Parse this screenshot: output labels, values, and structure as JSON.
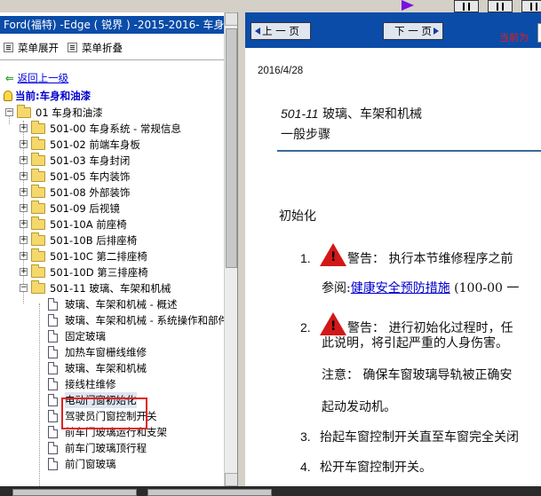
{
  "left_panel": {
    "title": "Ford(福特) -Edge ( 锐界 ) -2015-2016- 车身和",
    "expand_label": "菜单展开",
    "collapse_label": "菜单折叠",
    "back_label": "返回上一级",
    "current_label": "当前:车身和油漆",
    "tree": [
      {
        "label": "01 车身和油漆",
        "type": "folder",
        "expanded": true
      },
      {
        "label": "501-00 车身系统 - 常规信息",
        "type": "folder"
      },
      {
        "label": "501-02 前端车身板",
        "type": "folder"
      },
      {
        "label": "501-03 车身封闭",
        "type": "folder"
      },
      {
        "label": "501-05 车内装饰",
        "type": "folder"
      },
      {
        "label": "501-08 外部装饰",
        "type": "folder"
      },
      {
        "label": "501-09 后视镜",
        "type": "folder"
      },
      {
        "label": "501-10A 前座椅",
        "type": "folder"
      },
      {
        "label": "501-10B 后排座椅",
        "type": "folder"
      },
      {
        "label": "501-10C 第二排座椅",
        "type": "folder"
      },
      {
        "label": "501-10D 第三排座椅",
        "type": "folder"
      },
      {
        "label": "501-11 玻璃、车架和机械",
        "type": "folder",
        "expanded": true
      },
      {
        "label": "玻璃、车架和机械 - 概述",
        "type": "doc"
      },
      {
        "label": "玻璃、车架和机械 - 系统操作和部件",
        "type": "doc"
      },
      {
        "label": "固定玻璃",
        "type": "doc"
      },
      {
        "label": "加热车窗栅线维修",
        "type": "doc"
      },
      {
        "label": "玻璃、车架和机械",
        "type": "doc"
      },
      {
        "label": "接线柱维修",
        "type": "doc"
      },
      {
        "label": "电动门窗初始化",
        "type": "doc",
        "selected": true
      },
      {
        "label": "驾驶员门窗控制开关",
        "type": "doc"
      },
      {
        "label": "前车门玻璃运行和支架",
        "type": "doc"
      },
      {
        "label": "前车门玻璃顶行程",
        "type": "doc"
      },
      {
        "label": "前门窗玻璃",
        "type": "doc"
      }
    ]
  },
  "nav": {
    "prev_label": "上 一 页",
    "next_label": "下 一 页",
    "current_page_label": "当前为"
  },
  "doc": {
    "date": "2016/4/28",
    "code": "501-11",
    "title": "玻璃、车架和机械",
    "subtitle": "一般步骤",
    "section": "初始化",
    "step1_num": "1.",
    "step1_warn": "警告：",
    "step1_text": "执行本节维修程序之前",
    "step1_ref_prefix": "参阅:",
    "step1_ref_link": "健康安全预防措施",
    "step1_ref_suffix": "(100-00 一",
    "step2_num": "2.",
    "step2_warn": "警告：",
    "step2_text": "进行初始化过程时，任",
    "step2_line2": "此说明，将引起严重的人身伤害。",
    "step2_note": "注意：  确保车窗玻璃导轨被正确安",
    "step2_line4": "起动发动机。",
    "step3_num": "3.",
    "step3_text": "抬起车窗控制开关直至车窗完全关闭",
    "step4_num": "4.",
    "step4_text": "松开车窗控制开关。"
  },
  "colors": {
    "title_bar": "#0a4ca8",
    "nav_bar": "#0a4ca8",
    "highlight_box": "#e02020",
    "link": "#0000cc",
    "warning": "#d21818"
  }
}
